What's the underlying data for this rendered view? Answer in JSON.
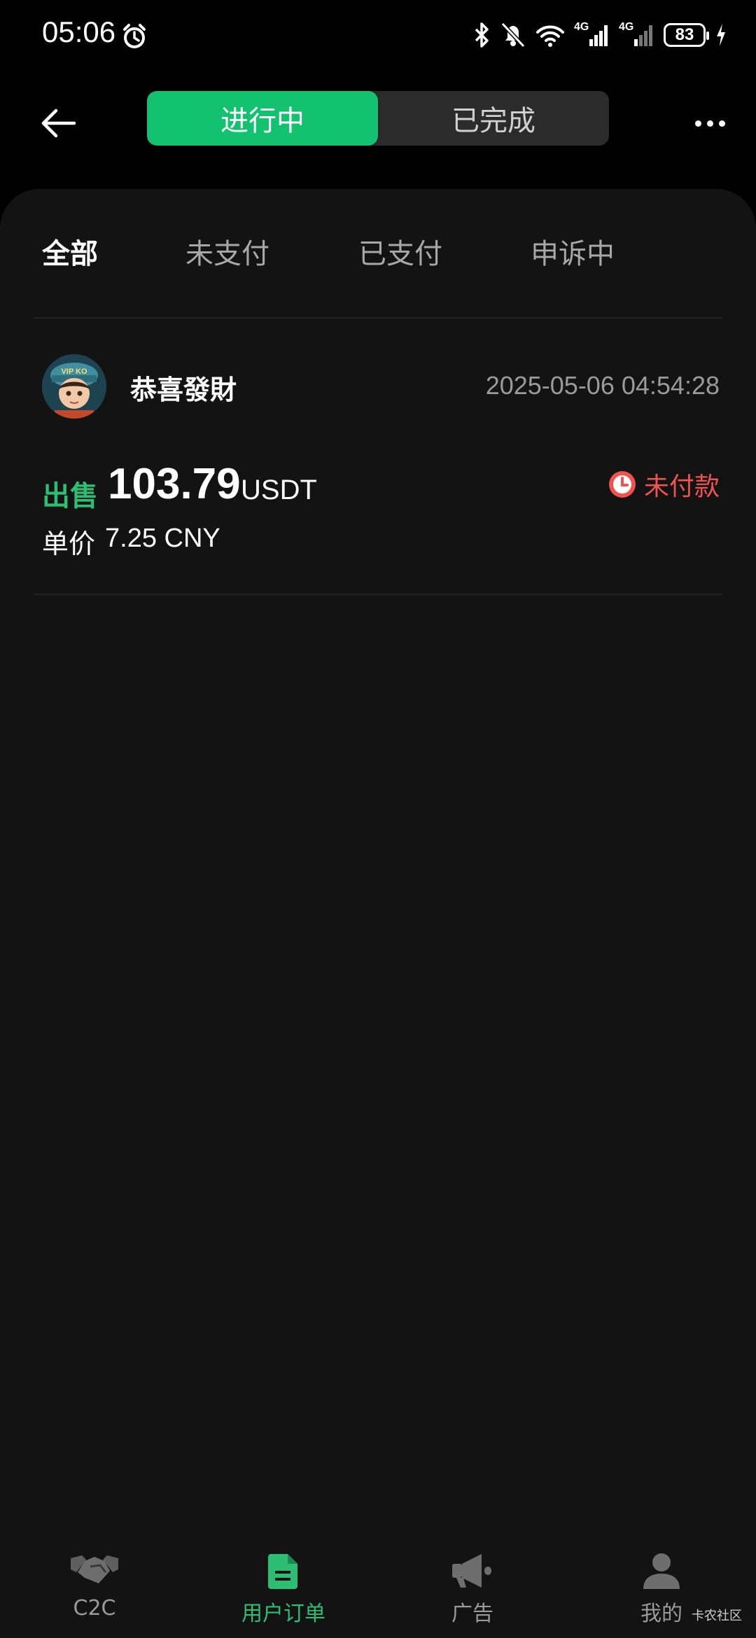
{
  "status_bar": {
    "time": "05:06",
    "battery": "83",
    "network_1": "4G",
    "network_2": "4G"
  },
  "header": {
    "tabs": [
      {
        "label": "进行中",
        "active": true
      },
      {
        "label": "已完成",
        "active": false
      }
    ]
  },
  "filter_tabs": [
    {
      "label": "全部",
      "active": true
    },
    {
      "label": "未支付",
      "active": false
    },
    {
      "label": "已支付",
      "active": false
    },
    {
      "label": "申诉中",
      "active": false
    }
  ],
  "orders": [
    {
      "user_name": "恭喜發財",
      "avatar_text": "VIP KO",
      "timestamp": "2025-05-06 04:54:28",
      "side": "出售",
      "amount": "103.79",
      "currency": "USDT",
      "price_label": "单价",
      "price_value": "7.25 CNY",
      "status": "未付款"
    }
  ],
  "bottom_nav": [
    {
      "label": "C2C",
      "icon": "handshake-icon",
      "active": false
    },
    {
      "label": "用户订单",
      "icon": "document-icon",
      "active": true
    },
    {
      "label": "广告",
      "icon": "megaphone-icon",
      "active": false
    },
    {
      "label": "我的",
      "icon": "user-icon",
      "active": false
    }
  ],
  "watermark": "卡农社区",
  "colors": {
    "accent": "#13c26f",
    "sell": "#2dbd73",
    "status_unpaid": "#ef5350",
    "background": "#131313"
  }
}
